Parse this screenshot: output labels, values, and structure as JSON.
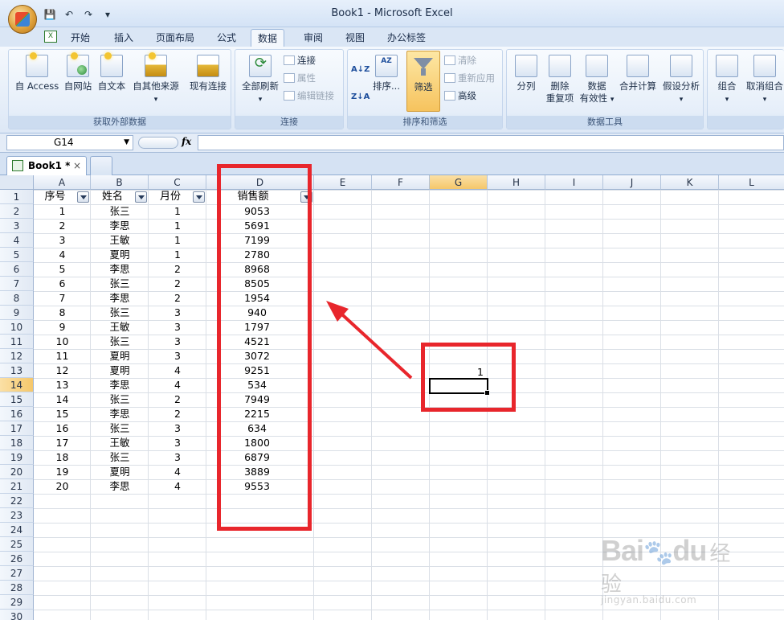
{
  "window": {
    "title": "Book1 - Microsoft Excel"
  },
  "quick_access": {
    "save": "💾",
    "undo": "↶",
    "redo": "↷",
    "more": "▾"
  },
  "tabs": [
    "开始",
    "插入",
    "页面布局",
    "公式",
    "数据",
    "审阅",
    "视图",
    "办公标签"
  ],
  "active_tab": "数据",
  "ribbon": {
    "groups": {
      "external": "获取外部数据",
      "connections": "连接",
      "sort_filter": "排序和筛选",
      "data_tools": "数据工具"
    },
    "buttons": {
      "access": "自 Access",
      "web": "自网站",
      "text": "自文本",
      "other": "自其他来源",
      "existing": "现有连接",
      "refresh_all": "全部刷新",
      "connections": "连接",
      "properties": "属性",
      "edit_links": "编辑链接",
      "sort_az": "A↓Z",
      "sort_za": "Z↓A",
      "sort": "排序...",
      "filter": "筛选",
      "clear": "清除",
      "reapply": "重新应用",
      "advanced": "高级",
      "split": "分列",
      "remove_dup_1": "删除",
      "remove_dup_2": "重复项",
      "validation_1": "数据",
      "validation_2": "有效性",
      "consolidate": "合并计算",
      "whatif": "假设分析",
      "group": "组合",
      "ungroup": "取消组合"
    }
  },
  "formula_bar": {
    "name_box": "G14",
    "fx": "fx",
    "formula": ""
  },
  "workbook_tab": {
    "name": "Book1 *",
    "close": "×"
  },
  "columns": [
    "A",
    "B",
    "C",
    "D",
    "E",
    "F",
    "G",
    "H",
    "I",
    "J",
    "K",
    "L"
  ],
  "selected_column": "G",
  "selected_row": 14,
  "table": {
    "headers": [
      "序号",
      "姓名",
      "月份",
      "销售额"
    ],
    "rows": [
      [
        "1",
        "张三",
        "1",
        "9053"
      ],
      [
        "2",
        "李思",
        "1",
        "5691"
      ],
      [
        "3",
        "王敏",
        "1",
        "7199"
      ],
      [
        "4",
        "夏明",
        "1",
        "2780"
      ],
      [
        "5",
        "李思",
        "2",
        "8968"
      ],
      [
        "6",
        "张三",
        "2",
        "8505"
      ],
      [
        "7",
        "李思",
        "2",
        "1954"
      ],
      [
        "8",
        "张三",
        "3",
        "940"
      ],
      [
        "9",
        "王敏",
        "3",
        "1797"
      ],
      [
        "10",
        "张三",
        "3",
        "4521"
      ],
      [
        "11",
        "夏明",
        "3",
        "3072"
      ],
      [
        "12",
        "夏明",
        "4",
        "9251"
      ],
      [
        "13",
        "李思",
        "4",
        "534"
      ],
      [
        "14",
        "张三",
        "2",
        "7949"
      ],
      [
        "15",
        "李思",
        "2",
        "2215"
      ],
      [
        "16",
        "张三",
        "3",
        "634"
      ],
      [
        "17",
        "王敏",
        "3",
        "1800"
      ],
      [
        "18",
        "张三",
        "3",
        "6879"
      ],
      [
        "19",
        "夏明",
        "4",
        "3889"
      ],
      [
        "20",
        "李思",
        "4",
        "9553"
      ]
    ]
  },
  "cell_g13": "1",
  "watermark": {
    "brand": "Bai",
    "brand2": "du",
    "jingyan": "经验",
    "url": "jingyan.baidu.com"
  },
  "colors": {
    "annotation": "#e8262c",
    "selection": "#f5c76a"
  }
}
